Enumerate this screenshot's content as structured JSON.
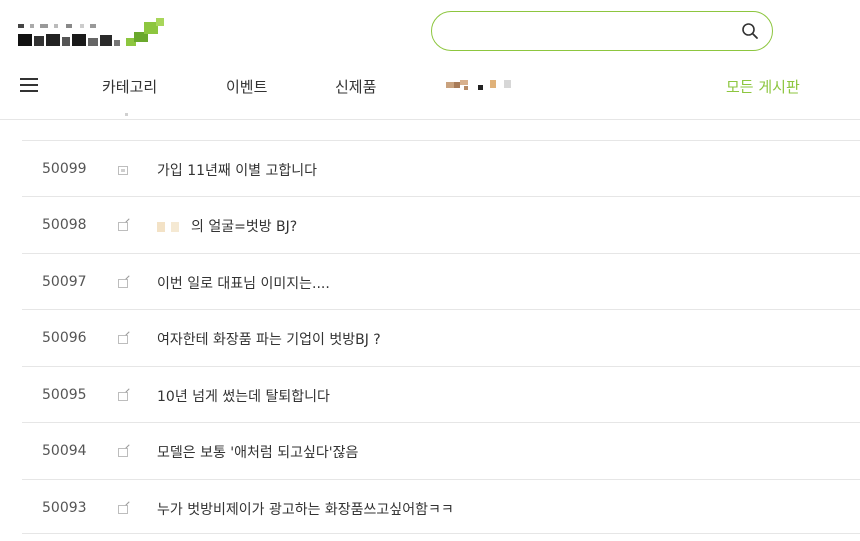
{
  "header": {
    "search": {
      "value": "",
      "placeholder": ""
    },
    "nav": {
      "items": [
        "카테고리",
        "이벤트",
        "신제품"
      ],
      "right_item": "모든 게시판"
    }
  },
  "posts": [
    {
      "number": "50099",
      "title": "가입 11년째 이별 고합니다",
      "icon": "notice-icon"
    },
    {
      "number": "50098",
      "title": "의 얼굴=벗방 BJ?",
      "icon": "edit-icon"
    },
    {
      "number": "50097",
      "title": "이번 일로 대표님 이미지는....",
      "icon": "edit-icon"
    },
    {
      "number": "50096",
      "title": "여자한테 화장품 파는 기업이 벗방BJ ?",
      "icon": "edit-icon"
    },
    {
      "number": "50095",
      "title": "10년 넘게 썼는데 탈퇴합니다",
      "icon": "edit-icon"
    },
    {
      "number": "50094",
      "title": "모델은 보통 '애처럼 되고싶다'잖음",
      "icon": "edit-icon"
    },
    {
      "number": "50093",
      "title": "누가 벗방비제이가 광고하는 화장품쓰고싶어함ㅋㅋ",
      "icon": "edit-icon"
    }
  ],
  "colors": {
    "accent": "#8dc63f",
    "divider": "#e6e6e6",
    "text": "#333333"
  }
}
